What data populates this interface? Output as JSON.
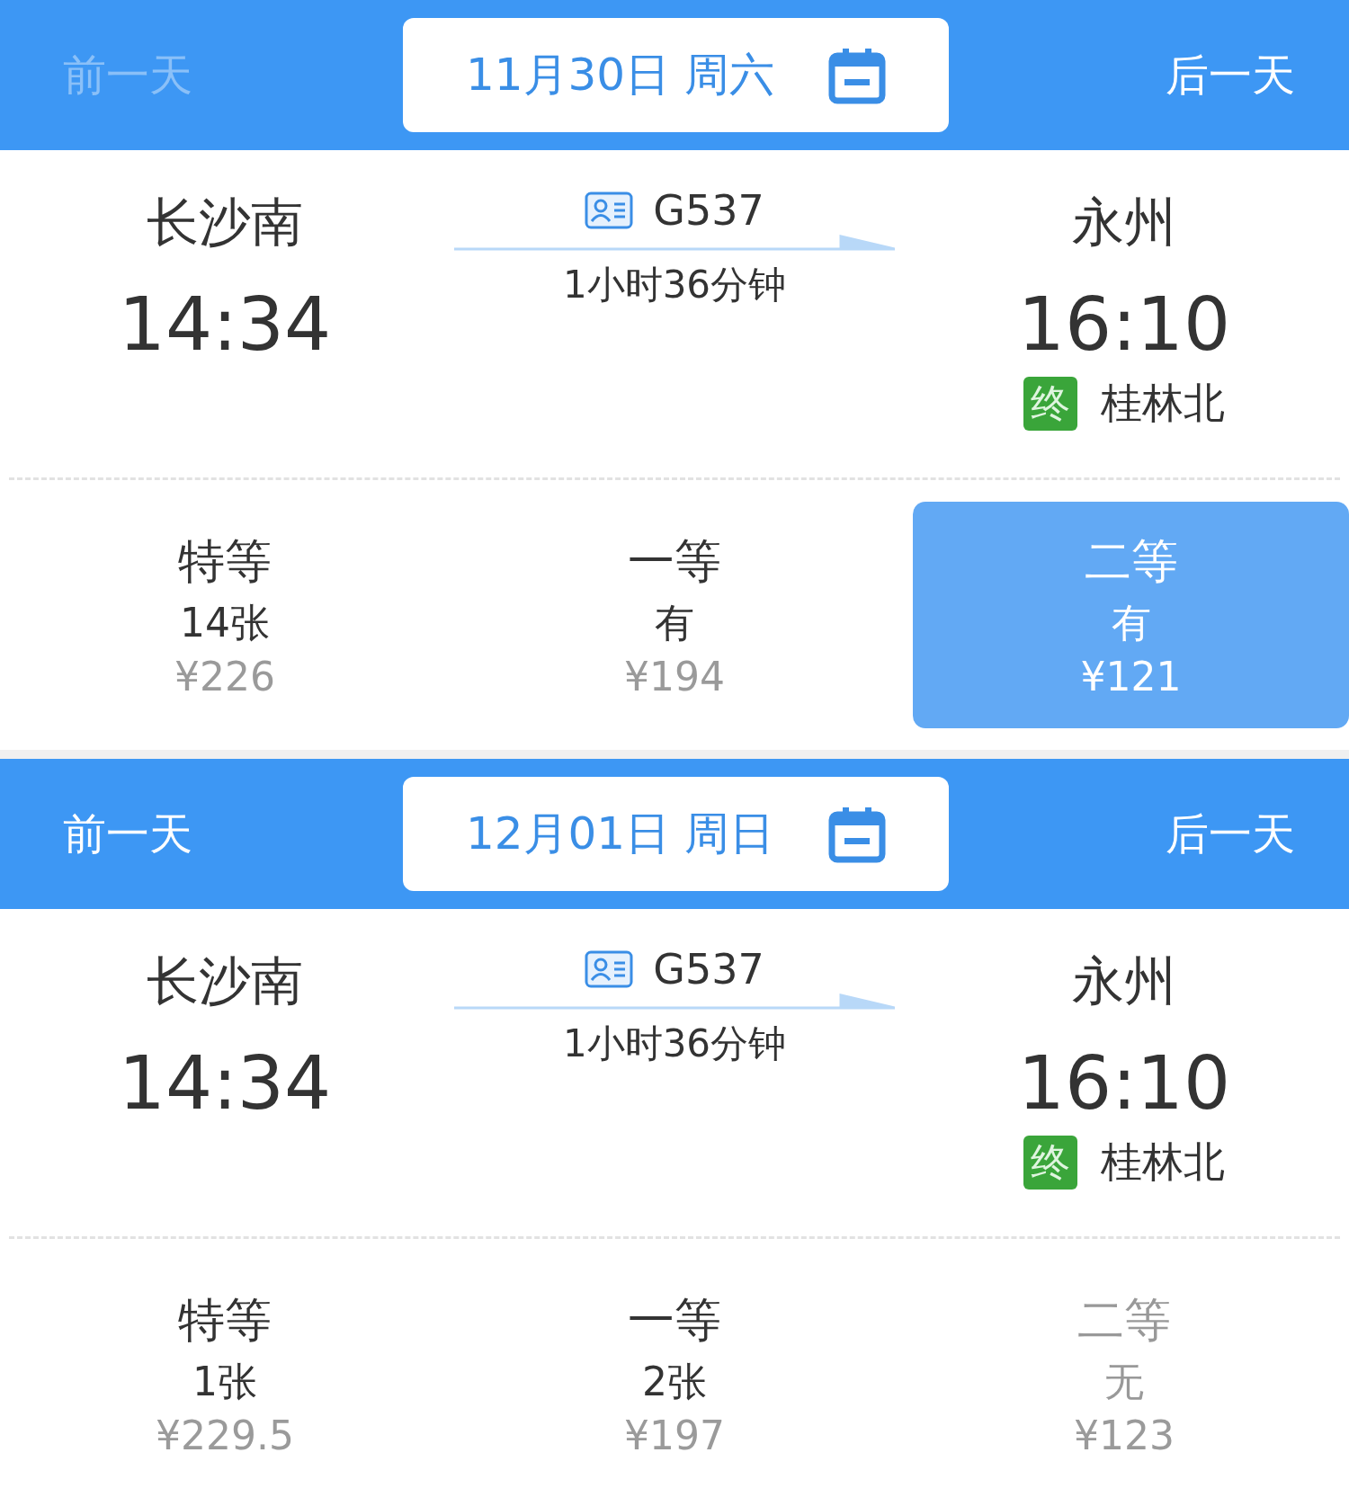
{
  "panels": [
    {
      "prev_day": {
        "label": "前一天",
        "disabled": true
      },
      "date": "11月30日 周六",
      "next_day": {
        "label": "后一天",
        "disabled": false
      },
      "origin": "长沙南",
      "depart_time": "14:34",
      "train": "G537",
      "duration": "1小时36分钟",
      "destination": "永州",
      "arrive_time": "16:10",
      "terminus_badge": "终",
      "terminus": "桂林北",
      "seats": [
        {
          "class": "特等",
          "availability": "14张",
          "price": "¥226",
          "selected": false,
          "available": true
        },
        {
          "class": "一等",
          "availability": "有",
          "price": "¥194",
          "selected": false,
          "available": true
        },
        {
          "class": "二等",
          "availability": "有",
          "price": "¥121",
          "selected": true,
          "available": true
        }
      ]
    },
    {
      "prev_day": {
        "label": "前一天",
        "disabled": false
      },
      "date": "12月01日 周日",
      "next_day": {
        "label": "后一天",
        "disabled": false
      },
      "origin": "长沙南",
      "depart_time": "14:34",
      "train": "G537",
      "duration": "1小时36分钟",
      "destination": "永州",
      "arrive_time": "16:10",
      "terminus_badge": "终",
      "terminus": "桂林北",
      "seats": [
        {
          "class": "特等",
          "availability": "1张",
          "price": "¥229.5",
          "selected": false,
          "available": true
        },
        {
          "class": "一等",
          "availability": "2张",
          "price": "¥197",
          "selected": false,
          "available": true
        },
        {
          "class": "二等",
          "availability": "无",
          "price": "¥123",
          "selected": false,
          "available": false
        }
      ]
    }
  ]
}
